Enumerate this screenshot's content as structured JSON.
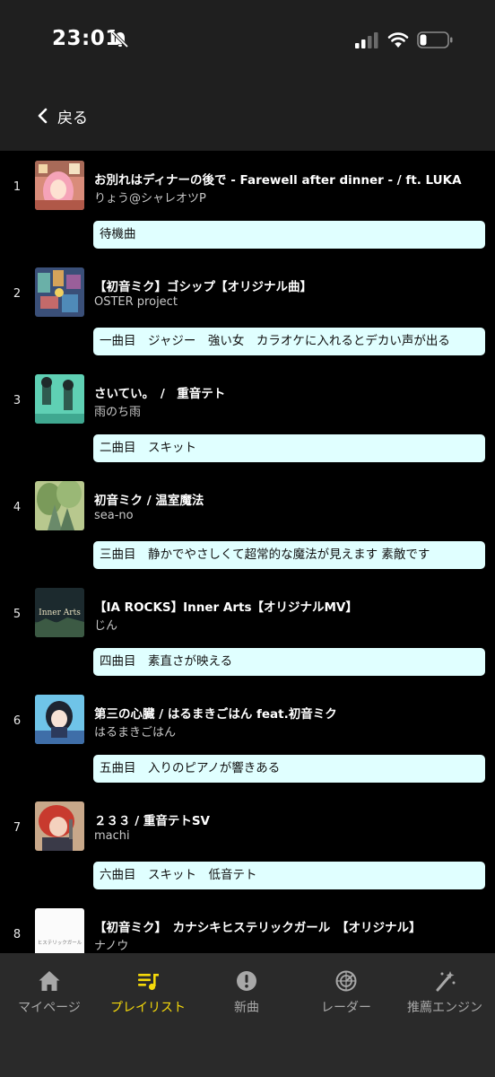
{
  "status_bar": {
    "time": "23:01"
  },
  "nav": {
    "back_label": "戻る"
  },
  "accent_color": "#f5d90a",
  "note_color": "#e0ffff",
  "playlist": [
    {
      "number": "1",
      "title": "お別れはディナーの後で - Farewell after dinner - / ft. LUKA",
      "artist": "りょう@シャレオツP",
      "note": "待機曲"
    },
    {
      "number": "2",
      "title": "【初音ミク】ゴシップ【オリジナル曲】",
      "artist": "OSTER project",
      "note": "一曲目　ジャジー　強い女　カラオケに入れるとデカい声が出る"
    },
    {
      "number": "3",
      "title": "さいてい。　/　重音テト",
      "artist": "雨のち雨",
      "note": "二曲目　スキット"
    },
    {
      "number": "4",
      "title": "初音ミク / 温室魔法",
      "artist": "sea-no",
      "note": "三曲目　静かでやさしくて超常的な魔法が見えます 素敵です"
    },
    {
      "number": "5",
      "title": "【IA ROCKS】Inner Arts【オリジナルMV】",
      "artist": "じん",
      "thumb_text": "Inner Arts",
      "note": "四曲目　素直さが映える"
    },
    {
      "number": "6",
      "title": "第三の心臓 / はるまきごはん feat.初音ミク",
      "artist": "はるまきごはん",
      "note": "五曲目　入りのピアノが響きある"
    },
    {
      "number": "7",
      "title": "２３３ / 重音テトSV",
      "artist": "machi",
      "note": "六曲目　スキット　低音テト"
    },
    {
      "number": "8",
      "title": "【初音ミク】　カナシキヒステリックガール　【オリジナル】",
      "artist": "ナノウ",
      "thumb_text": "ヒステリックガール"
    }
  ],
  "tabs": [
    {
      "label": "マイページ",
      "icon": "home-icon",
      "active": false
    },
    {
      "label": "プレイリスト",
      "icon": "playlist-icon",
      "active": true
    },
    {
      "label": "新曲",
      "icon": "alert-icon",
      "active": false
    },
    {
      "label": "レーダー",
      "icon": "radar-icon",
      "active": false
    },
    {
      "label": "推薦エンジン",
      "icon": "magic-wand-icon",
      "active": false
    }
  ]
}
